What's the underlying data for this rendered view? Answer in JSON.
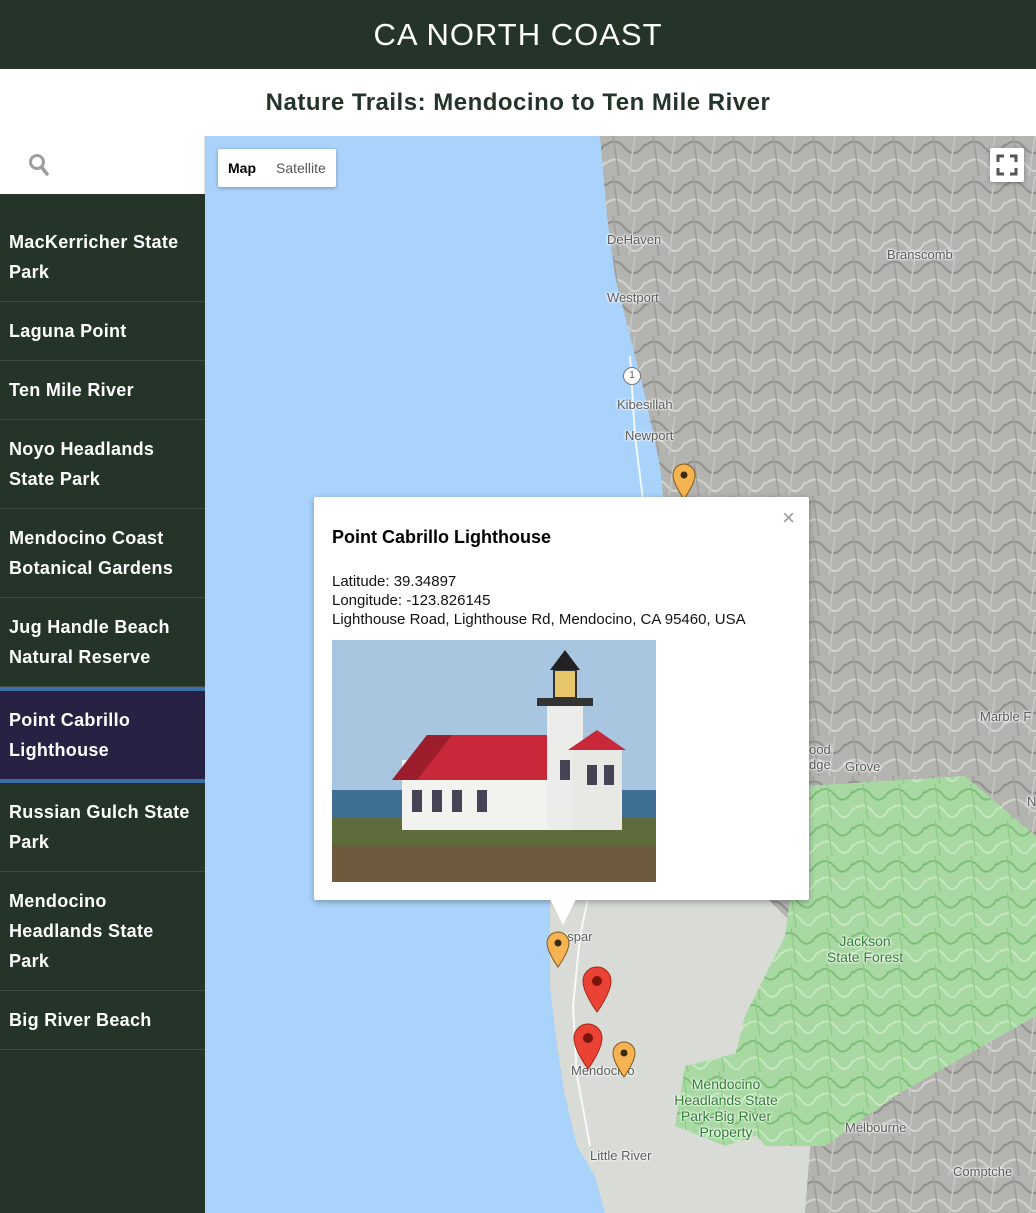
{
  "header": {
    "title": "CA NORTH COAST"
  },
  "subtitle": "Nature Trails: Mendocino to Ten Mile River",
  "search": {
    "placeholder": "",
    "icon": "search-icon"
  },
  "trails": [
    {
      "name": "MacKerricher State Park"
    },
    {
      "name": "Laguna Point"
    },
    {
      "name": "Ten Mile River"
    },
    {
      "name": "Noyo Headlands State Park"
    },
    {
      "name": "Mendocino Coast Botanical Gardens"
    },
    {
      "name": "Jug Handle Beach Natural Reserve"
    },
    {
      "name": "Point Cabrillo Lighthouse",
      "active": true
    },
    {
      "name": "Russian Gulch State Park"
    },
    {
      "name": "Mendocino Headlands State Park"
    },
    {
      "name": "Big River Beach"
    }
  ],
  "map": {
    "type_map": "Map",
    "type_satellite": "Satellite",
    "places": {
      "dehaven": "DeHaven",
      "branscomb": "Branscomb",
      "westport": "Westport",
      "route": "1",
      "kibesillah": "Kibesillah",
      "newport": "Newport",
      "marble": "Marble F",
      "wood": "ood",
      "idge": "dge",
      "grove": "Grove",
      "n": "N",
      "caspar": "aspar",
      "jackson": "Jackson State Forest",
      "mendocino": "Mendocino",
      "headlands": "Mendocino Headlands State Park-Big River Property",
      "melbourne": "Melbourne",
      "littleriver": "Little River",
      "comptche": "Comptche"
    },
    "colors": {
      "water": "#aad3fb",
      "terrain": "#9a9a9a",
      "forest": "#a8d8a0",
      "marker_selected": "#ea4335",
      "marker_default": "#f6b352"
    }
  },
  "infowindow": {
    "title": "Point Cabrillo Lighthouse",
    "latitude": "Latitude: 39.34897",
    "longitude": "Longitude: -123.826145",
    "address": "Lighthouse Road, Lighthouse Rd, Mendocino, CA 95460, USA",
    "close": "×"
  }
}
